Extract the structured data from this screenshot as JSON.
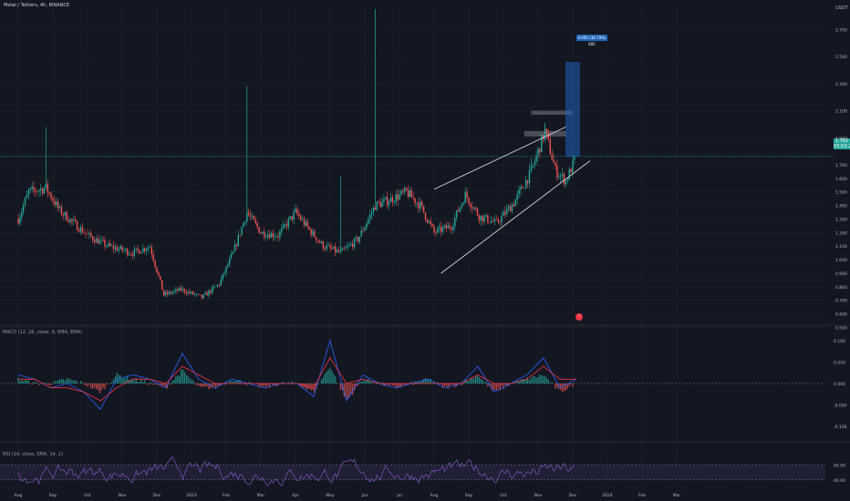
{
  "header": {
    "title": "Metal / Tethers, 4h, BINANCE",
    "unit": "USDT"
  },
  "indicators": {
    "macd_label": "MACD (12, 26, close, 9, EMA, EMA)",
    "rsi_label": "RSI (14, close, SMA, 14, 2)"
  },
  "price_tag": {
    "value": "1.762",
    "countdown": "03:53:22"
  },
  "position_label": "0.695 (38.79%) 695",
  "colors": {
    "background": "#131722",
    "up": "#26a69a",
    "down": "#ef5350",
    "macd_line": "#2962ff",
    "signal_line": "#f23645",
    "rsi_line": "#7e57c2",
    "rsi_band": "#7e57c2",
    "grid": "#1e222d",
    "axis_text": "#b2b5be",
    "trendline": "#d1d4dc",
    "position_box": "#1e63b7"
  },
  "chart_data": [
    {
      "type": "candlestick",
      "title": "Metal / Tethers, 4h, BINANCE",
      "ylabel": "USDT",
      "ylim": [
        0.55,
        2.85
      ],
      "y_ticks": [
        "2.700",
        "2.500",
        "2.300",
        "2.100",
        "1.900",
        "1.700",
        "1.600",
        "1.500",
        "1.400",
        "1.300",
        "1.200",
        "1.100",
        "1.000",
        "0.900",
        "0.800",
        "0.700",
        "0.600",
        "0.500"
      ],
      "x_ticks": [
        "Aug",
        "Sep",
        "Oct",
        "Nov",
        "Dec",
        "2023",
        "Feb",
        "Mar",
        "Apr",
        "May",
        "Jun",
        "Jul",
        "Aug",
        "Sep",
        "Oct",
        "Nov",
        "Dec",
        "2024",
        "Feb",
        "Mar"
      ],
      "price_path": [
        {
          "t": 0.0,
          "v": 1.3
        },
        {
          "t": 0.3,
          "v": 1.5
        },
        {
          "t": 0.8,
          "v": 1.53
        },
        {
          "t": 1.2,
          "v": 1.36
        },
        {
          "t": 2.0,
          "v": 1.18
        },
        {
          "t": 2.6,
          "v": 1.1
        },
        {
          "t": 3.3,
          "v": 1.05
        },
        {
          "t": 3.8,
          "v": 1.1
        },
        {
          "t": 4.2,
          "v": 0.74
        },
        {
          "t": 4.7,
          "v": 0.78
        },
        {
          "t": 5.3,
          "v": 0.72
        },
        {
          "t": 5.8,
          "v": 0.82
        },
        {
          "t": 6.2,
          "v": 1.05
        },
        {
          "t": 6.6,
          "v": 1.35
        },
        {
          "t": 7.0,
          "v": 1.2
        },
        {
          "t": 7.5,
          "v": 1.18
        },
        {
          "t": 8.0,
          "v": 1.35
        },
        {
          "t": 8.4,
          "v": 1.22
        },
        {
          "t": 8.8,
          "v": 1.1
        },
        {
          "t": 9.3,
          "v": 1.05
        },
        {
          "t": 9.8,
          "v": 1.15
        },
        {
          "t": 10.3,
          "v": 1.4
        },
        {
          "t": 10.8,
          "v": 1.45
        },
        {
          "t": 11.2,
          "v": 1.5
        },
        {
          "t": 11.6,
          "v": 1.4
        },
        {
          "t": 12.0,
          "v": 1.2
        },
        {
          "t": 12.5,
          "v": 1.25
        },
        {
          "t": 12.9,
          "v": 1.48
        },
        {
          "t": 13.3,
          "v": 1.32
        },
        {
          "t": 13.8,
          "v": 1.27
        },
        {
          "t": 14.3,
          "v": 1.42
        },
        {
          "t": 14.8,
          "v": 1.65
        },
        {
          "t": 15.2,
          "v": 1.95
        },
        {
          "t": 15.5,
          "v": 1.66
        },
        {
          "t": 15.8,
          "v": 1.58
        },
        {
          "t": 16.1,
          "v": 1.76
        }
      ],
      "wick_spikes": [
        {
          "t": 0.8,
          "v": 1.98
        },
        {
          "t": 6.6,
          "v": 2.28
        },
        {
          "t": 10.3,
          "v": 2.85
        },
        {
          "t": 9.3,
          "v": 1.62
        },
        {
          "t": 14.8,
          "v": 1.75
        },
        {
          "t": 15.2,
          "v": 2.01
        }
      ],
      "current_price": 1.762,
      "trendlines": [
        {
          "from": {
            "t": 12.0,
            "v": 1.52
          },
          "to": {
            "t": 15.8,
            "v": 1.98
          }
        },
        {
          "from": {
            "t": 12.2,
            "v": 0.9
          },
          "to": {
            "t": 16.5,
            "v": 1.73
          }
        }
      ],
      "zones": [
        {
          "from_t": 14.6,
          "to_t": 15.8,
          "v_low": 1.91,
          "v_high": 1.95
        },
        {
          "from_t": 14.8,
          "to_t": 16.0,
          "v_low": 2.07,
          "v_high": 2.1
        }
      ],
      "position_box": {
        "from_t": 15.8,
        "to_t": 16.2,
        "v_low": 1.762,
        "v_high": 2.457
      }
    },
    {
      "type": "line",
      "title": "MACD (12, 26, close, 9, EMA, EMA)",
      "ylim": [
        -0.125,
        0.125
      ],
      "y_ticks": [
        "0.100",
        "0.050",
        "0.000",
        "-0.050",
        "-0.100"
      ],
      "series": [
        {
          "name": "MACD",
          "values": [
            0.02,
            0.01,
            -0.01,
            0.0,
            -0.02,
            -0.06,
            0.01,
            0.02,
            0.01,
            -0.01,
            0.07,
            0.01,
            -0.01,
            0.01,
            0.0,
            -0.01,
            0.0,
            0.0,
            -0.03,
            0.1,
            -0.04,
            0.02,
            0.0,
            -0.01,
            0.0,
            0.01,
            -0.01,
            0.0,
            0.04,
            -0.02,
            0.0,
            0.02,
            0.06,
            -0.01,
            0.01
          ]
        },
        {
          "name": "Signal",
          "values": [
            0.01,
            0.01,
            -0.01,
            -0.01,
            -0.02,
            -0.04,
            -0.01,
            0.01,
            0.01,
            0.0,
            0.04,
            0.02,
            0.0,
            0.0,
            0.0,
            0.0,
            0.0,
            0.0,
            -0.01,
            0.06,
            0.0,
            0.01,
            0.0,
            0.0,
            0.0,
            0.0,
            0.0,
            0.0,
            0.02,
            0.0,
            0.0,
            0.01,
            0.04,
            0.01,
            0.01
          ]
        }
      ]
    },
    {
      "type": "line",
      "title": "RSI (14, close, SMA, 14, 2)",
      "ylim": [
        30,
        85
      ],
      "y_ticks": [
        "60.00",
        "40.00"
      ],
      "band": [
        40,
        60
      ]
    }
  ]
}
